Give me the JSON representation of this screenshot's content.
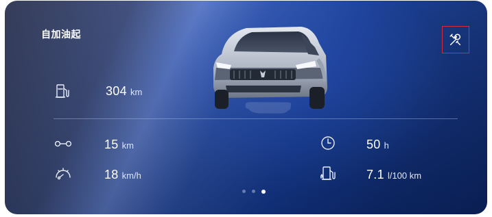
{
  "card": {
    "title": "自加油起"
  },
  "settings": {
    "icon": "tools-icon",
    "highlight_color": "#d72a3c"
  },
  "stats": {
    "range": {
      "icon": "fuel-pump-icon",
      "value": "304",
      "unit": "km"
    },
    "distance": {
      "icon": "trip-distance-icon",
      "value": "15",
      "unit": "km"
    },
    "time": {
      "icon": "clock-icon",
      "value": "50",
      "unit": "h"
    },
    "speed": {
      "icon": "speedometer-icon",
      "value": "18",
      "unit": "km/h"
    },
    "consumption": {
      "icon": "fuel-consumption-icon",
      "value": "7.1",
      "unit": "l/100 km"
    }
  },
  "pager": {
    "pages": 3,
    "active_page": 3
  },
  "colors": {
    "background_dark": "#0f2f7a",
    "background_light": "#5a78c4",
    "text": "#ffffff"
  }
}
